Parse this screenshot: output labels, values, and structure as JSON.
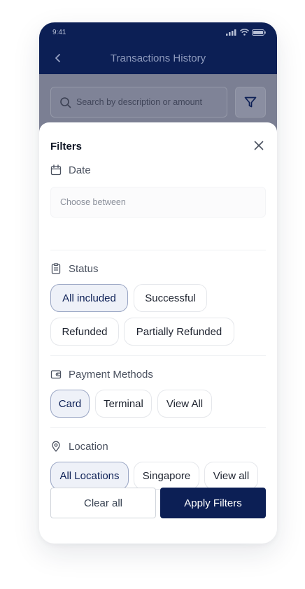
{
  "status_bar": {
    "time": "9:41"
  },
  "nav": {
    "title": "Transactions History"
  },
  "search": {
    "placeholder": "Search by description or amount"
  },
  "sheet": {
    "title": "Filters",
    "date": {
      "label": "Date",
      "placeholder": "Choose between"
    },
    "status": {
      "label": "Status",
      "options": [
        {
          "label": "All included",
          "selected": true
        },
        {
          "label": "Successful",
          "selected": false
        },
        {
          "label": "Refunded",
          "selected": false
        },
        {
          "label": "Partially Refunded",
          "selected": false
        }
      ]
    },
    "payment_methods": {
      "label": "Payment Methods",
      "options": [
        {
          "label": "Card",
          "selected": true
        },
        {
          "label": "Terminal",
          "selected": false
        },
        {
          "label": "View All",
          "selected": false
        }
      ]
    },
    "location": {
      "label": "Location",
      "options": [
        {
          "label": "All Locations",
          "selected": true
        },
        {
          "label": "Singapore",
          "selected": false
        },
        {
          "label": "View all",
          "selected": false
        }
      ]
    },
    "actions": {
      "clear_label": "Clear all",
      "apply_label": "Apply Filters"
    }
  },
  "colors": {
    "primary": "#0c1f55",
    "overlay": "#7b7f93",
    "chip_selected_bg": "#eef1f8",
    "chip_selected_border": "#9aa6c4"
  },
  "icons": {
    "back": "chevron-left-icon",
    "search": "search-icon",
    "filter": "funnel-icon",
    "close": "close-icon",
    "date": "calendar-icon",
    "status": "clipboard-icon",
    "payment": "wallet-icon",
    "location": "map-pin-icon"
  }
}
